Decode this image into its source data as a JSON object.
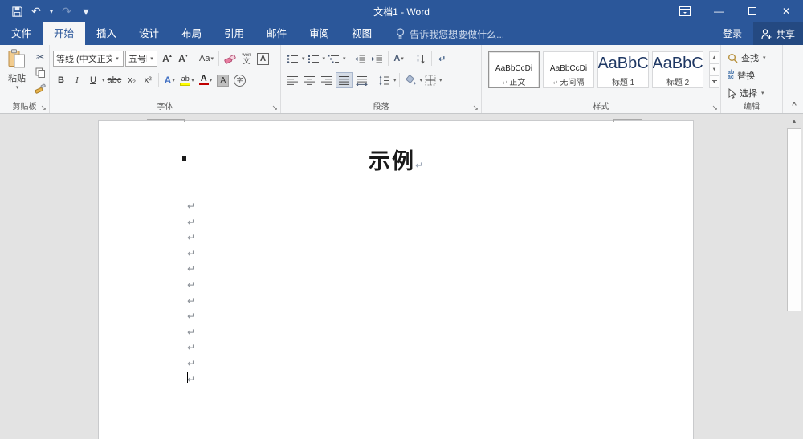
{
  "colors": {
    "titlebar_blue": "#2b579a",
    "ribbon_bg": "#f5f6f7",
    "doc_bg": "#e3e3e3",
    "highlight_yellow": "#ffff00",
    "font_color_red": "#c00000"
  },
  "title_bar": {
    "title": "文档1 - Word",
    "qat_icons": {
      "undo": "↶",
      "redo": "↷",
      "caret": "▾"
    },
    "window_icons": {
      "minimize": "—",
      "close": "✕"
    }
  },
  "tabs": {
    "file_label": "文件",
    "items": [
      {
        "label": "开始",
        "active": true
      },
      {
        "label": "插入"
      },
      {
        "label": "设计"
      },
      {
        "label": "布局"
      },
      {
        "label": "引用"
      },
      {
        "label": "邮件"
      },
      {
        "label": "审阅"
      },
      {
        "label": "视图"
      }
    ],
    "tell_me": "告诉我您想要做什么...",
    "sign_in": "登录",
    "share": "共享"
  },
  "ribbon": {
    "caret": "▾",
    "launcher": "↘",
    "collapse": "^",
    "clipboard": {
      "label": "剪贴板",
      "paste_label": "粘贴",
      "cut_glyph": "✂"
    },
    "font": {
      "label": "字体",
      "font_name": "等线 (中文正文)",
      "font_size": "五号",
      "grow": "A",
      "grow_mark": "▴",
      "shrink": "A",
      "shrink_mark": "▾",
      "change_case": "Aa",
      "bold": "B",
      "italic": "I",
      "underline": "U",
      "strikethrough": "abc",
      "subscript": "x₂",
      "superscript": "x²",
      "text_effects": "A",
      "highlight_ab": "ab",
      "font_color_a": "A",
      "char_shading_a": "A",
      "enclose_char": "字",
      "char_border_a": "A",
      "phonetic_top": "wén",
      "phonetic_bottom": "文"
    },
    "paragraph": {
      "label": "段落",
      "asian_layout": "A",
      "mark_glyph": "↵"
    },
    "styles": {
      "label": "样式",
      "scroll_up": "▲",
      "scroll_down": "▼",
      "items": [
        {
          "preview": "AaBbCcDi",
          "name": "正文",
          "mark": "↵",
          "selected": true
        },
        {
          "preview": "AaBbCcDi",
          "name": "无间隔",
          "mark": "↵"
        },
        {
          "preview": "AaBbC",
          "name": "标题 1",
          "large_preview": true
        },
        {
          "preview": "AaBbC",
          "name": "标题 2",
          "large_preview": true
        }
      ]
    },
    "editing": {
      "label": "编辑",
      "find": "查找",
      "replace": "替换",
      "select": "选择",
      "replace_icon_top": "ab",
      "replace_icon_bottom": "ac"
    }
  },
  "document": {
    "heading": "示例",
    "heading_mark": "↵",
    "paragraph_mark": "↵",
    "empty_paragraph_count": 12,
    "scroll_up_glyph": "▲"
  }
}
